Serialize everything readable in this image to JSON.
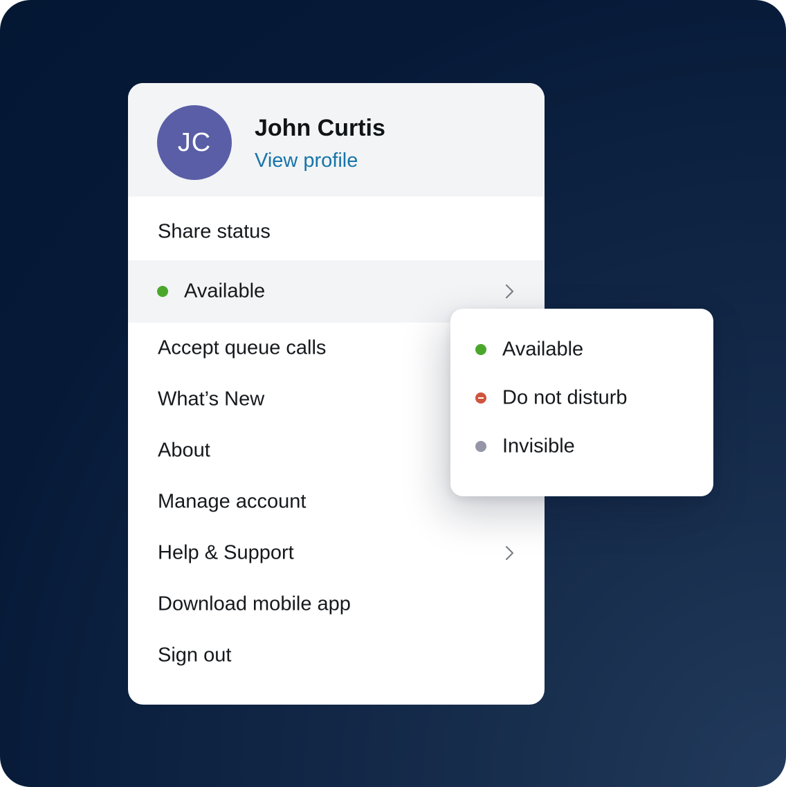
{
  "profile": {
    "initials": "JC",
    "name": "John Curtis",
    "view_profile_label": "View profile",
    "avatar_color": "#5a5ea6",
    "link_color": "#1874a8"
  },
  "menu": {
    "share_status_label": "Share status",
    "current_status": {
      "label": "Available",
      "color": "#4ba72c",
      "icon": "chevron-right-icon"
    },
    "items": [
      {
        "label": "Accept queue calls"
      },
      {
        "label": "What’s New"
      },
      {
        "label": "About"
      },
      {
        "label": "Manage account"
      },
      {
        "label": "Help & Support",
        "icon": "chevron-right-icon"
      },
      {
        "label": "Download mobile app"
      },
      {
        "label": "Sign out"
      }
    ]
  },
  "status_submenu": {
    "options": [
      {
        "label": "Available",
        "color": "#4ba72c",
        "icon": "status-dot-available-icon"
      },
      {
        "label": "Do not disturb",
        "color": "#d0543e",
        "icon": "status-dot-dnd-icon"
      },
      {
        "label": "Invisible",
        "color": "#9496a8",
        "icon": "status-dot-invisible-icon"
      }
    ]
  },
  "theme": {
    "background_color": "#041834",
    "header_bg": "#f2f4f6"
  }
}
